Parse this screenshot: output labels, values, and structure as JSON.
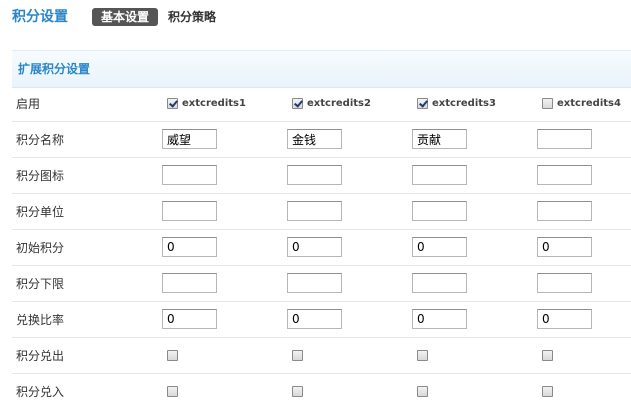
{
  "header": {
    "title": "积分设置",
    "tabs": [
      {
        "label": "基本设置",
        "active": true
      },
      {
        "label": "积分策略",
        "active": false
      }
    ]
  },
  "panel": {
    "title": "扩展积分设置"
  },
  "credits": [
    "extcredits1",
    "extcredits2",
    "extcredits3",
    "extcredits4"
  ],
  "rows": {
    "enable": {
      "label": "启用",
      "checked": [
        true,
        true,
        true,
        false
      ]
    },
    "name": {
      "label": "积分名称",
      "values": [
        "威望",
        "金钱",
        "贡献",
        ""
      ]
    },
    "icon": {
      "label": "积分图标",
      "values": [
        "",
        "",
        "",
        ""
      ]
    },
    "unit": {
      "label": "积分单位",
      "values": [
        "",
        "",
        "",
        ""
      ]
    },
    "initial": {
      "label": "初始积分",
      "values": [
        "0",
        "0",
        "0",
        "0"
      ]
    },
    "lower_limit": {
      "label": "积分下限",
      "values": [
        "",
        "",
        "",
        ""
      ]
    },
    "ratio": {
      "label": "兑换比率",
      "values": [
        "0",
        "0",
        "0",
        "0"
      ]
    },
    "exchange_out": {
      "label": "积分兑出",
      "checked": [
        false,
        false,
        false,
        false
      ]
    },
    "exchange_in": {
      "label": "积分兑入",
      "checked": [
        false,
        false,
        false,
        false
      ]
    }
  },
  "colors": {
    "accent": "#2a86c8",
    "active_tab_bg": "#555555",
    "panel_bg": "#eef6fb"
  }
}
